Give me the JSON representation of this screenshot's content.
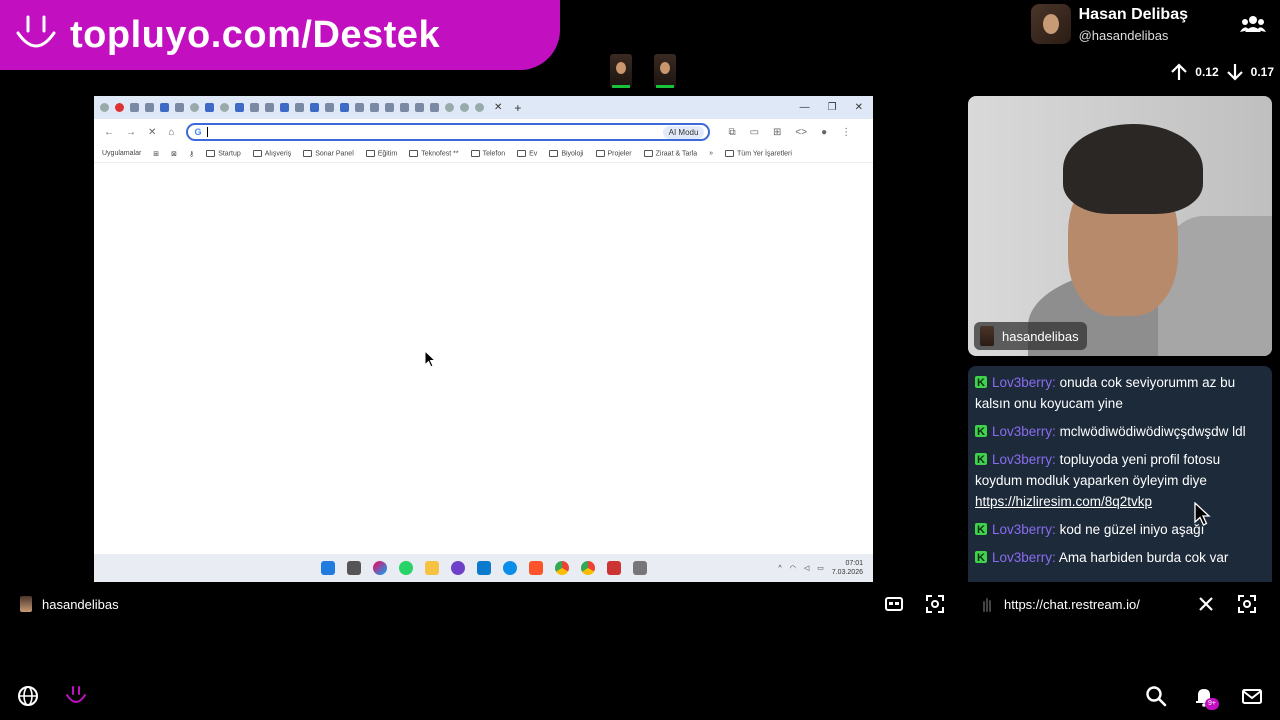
{
  "banner": {
    "text": "topluyo.com/Destek"
  },
  "profile": {
    "name": "Hasan Delibaş",
    "handle": "@hasandelibas"
  },
  "stats": {
    "upload": "0.12",
    "download": "0.17"
  },
  "browser": {
    "ai_mode": "AI Modu",
    "bookmarks": [
      "Uygulamalar",
      "Startup",
      "Alışveriş",
      "Sonar Panel",
      "Eğitim",
      "Teknofest **",
      "Telefon",
      "Ev",
      "Biyoloji",
      "Projeler",
      "Ziraat & Tarla",
      "Tüm Yer İşaretleri"
    ],
    "time": "07:01",
    "date": "7.03.2026"
  },
  "webcam": {
    "label": "hasandelibas"
  },
  "chat": {
    "messages": [
      {
        "user": "Lov3berry:",
        "text": "onuda cok seviyorumm az bu kalsın onu koyucam yine",
        "link": ""
      },
      {
        "user": "Lov3berry:",
        "text": "mclwödiwödiwödiwçşdwşdw ldl",
        "link": ""
      },
      {
        "user": "Lov3berry:",
        "text": "topluyoda yeni profil fotosu koydum modluk yaparken öyleyim diye",
        "link": "https://hizliresim.com/8q2tvkp"
      },
      {
        "user": "Lov3berry:",
        "text": "kod ne güzel iniyo aşağı",
        "link": ""
      },
      {
        "user": "Lov3berry:",
        "text": "Ama harbiden burda cok var",
        "link": ""
      }
    ]
  },
  "stream_label": "hasandelibas",
  "chat_url": "https://chat.restream.io/",
  "notifications_badge": "9+",
  "colors": {
    "brand": "#c20fbf",
    "chat_bg": "#1c2a3a",
    "username": "#8a6cf0",
    "kick_green": "#3fd34b"
  }
}
